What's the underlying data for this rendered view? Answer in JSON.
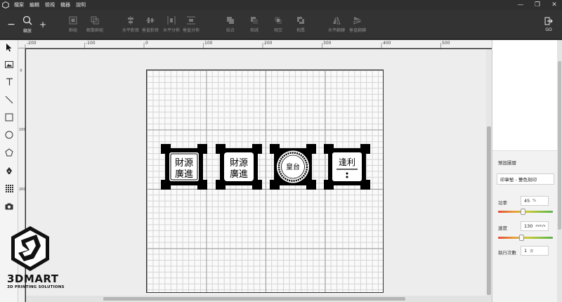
{
  "menu": [
    "檔案",
    "編輯",
    "檢視",
    "機器",
    "說明"
  ],
  "window_controls": {
    "minimize": "—",
    "restore": "❐",
    "close": "✕"
  },
  "toolbar": {
    "zoom_out": "−",
    "zoom_label": "縮放",
    "zoom_in": "+",
    "group": "群組",
    "ungroup": "解散群組",
    "align_h": "水平對齊",
    "align_v": "垂直對齊",
    "dist_h": "水平分佈",
    "dist_v": "垂直分佈",
    "union": "結合",
    "subtract": "相減",
    "intersect": "相交",
    "difference": "相異",
    "flip_h": "水平翻轉",
    "flip_v": "垂直翻轉",
    "go_label": "GO"
  },
  "ruler_top": [
    "-200",
    "-100",
    "0",
    "100",
    "200",
    "300",
    "400",
    "500"
  ],
  "ruler_left": [
    "0",
    "100",
    "200",
    "300"
  ],
  "right_panel": {
    "section_title": "預設圖層",
    "preset_value": "印章墊 - 雙色刻印",
    "power_label": "功率",
    "power_value": "45",
    "power_unit": "%",
    "power_fraction": 0.45,
    "speed_label": "速度",
    "speed_value": "130",
    "speed_unit": "mm/s",
    "speed_fraction": 0.42,
    "passes_label": "執行次數",
    "passes_value": "1",
    "passes_unit": "次"
  },
  "stamps": [
    {
      "text_a": "財源",
      "text_b": "廣進"
    },
    {
      "text_a": "財源",
      "text_b": "廣進"
    },
    {
      "text_a": "皇台",
      "text_b": ""
    },
    {
      "text_a": "逢利",
      "text_b": ""
    }
  ],
  "brand": {
    "name": "3DMART",
    "tagline": "3D PRINTING SOLUTIONS"
  },
  "colors": {
    "toolbar_bg": "#333333",
    "canvas_bg": "#ededed",
    "accent_slider_start": "#e44a3a",
    "accent_slider_end": "#5ab54a"
  }
}
